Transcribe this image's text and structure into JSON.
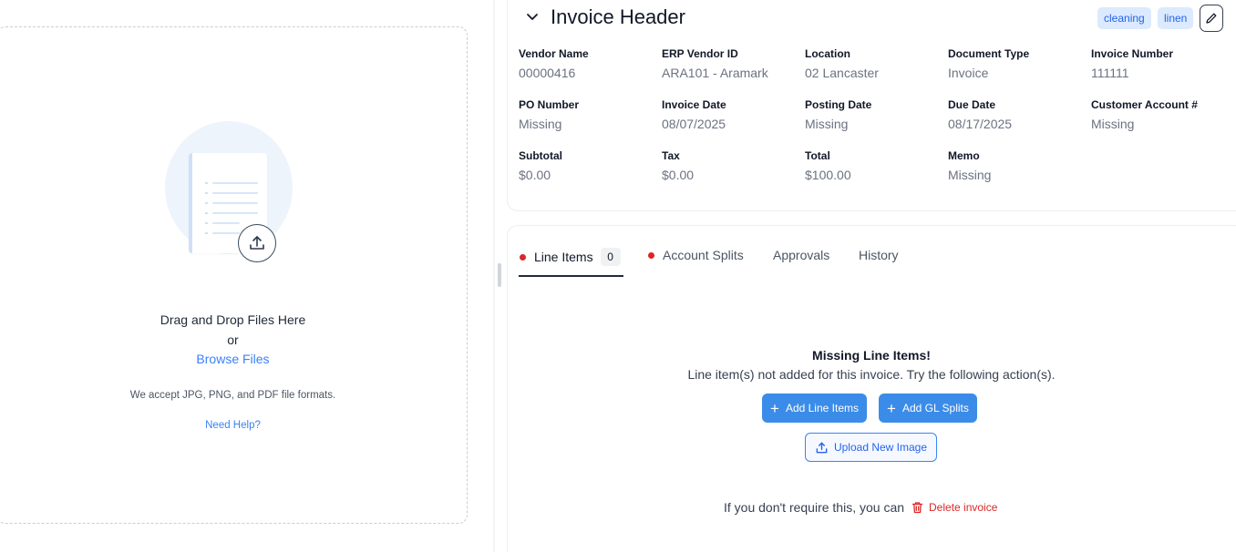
{
  "upload": {
    "drag_text": "Drag and Drop Files Here",
    "or_text": "or",
    "browse_label": "Browse Files",
    "formats_text": "We accept JPG, PNG, and PDF file formats.",
    "help_label": "Need Help?"
  },
  "header": {
    "title": "Invoice Header",
    "tags": [
      "cleaning",
      "linen"
    ],
    "fields": [
      {
        "label": "Vendor Name",
        "value": "00000416"
      },
      {
        "label": "ERP Vendor ID",
        "value": "ARA101 - Aramark"
      },
      {
        "label": "Location",
        "value": "02 Lancaster"
      },
      {
        "label": "Document Type",
        "value": "Invoice"
      },
      {
        "label": "Invoice Number",
        "value": "111111"
      },
      {
        "label": "PO Number",
        "value": "Missing"
      },
      {
        "label": "Invoice Date",
        "value": "08/07/2025"
      },
      {
        "label": "Posting Date",
        "value": "Missing"
      },
      {
        "label": "Due Date",
        "value": "08/17/2025"
      },
      {
        "label": "Customer Account #",
        "value": "Missing"
      },
      {
        "label": "Subtotal",
        "value": "$0.00"
      },
      {
        "label": "Tax",
        "value": "$0.00"
      },
      {
        "label": "Total",
        "value": "$100.00"
      },
      {
        "label": "Memo",
        "value": "Missing"
      }
    ]
  },
  "tabs": [
    {
      "label": "Line Items",
      "count": "0"
    },
    {
      "label": "Account Splits"
    },
    {
      "label": "Approvals"
    },
    {
      "label": "History"
    }
  ],
  "empty_state": {
    "title": "Missing Line Items!",
    "description": "Line item(s) not added for this invoice. Try the following action(s).",
    "add_line_items": "Add Line Items",
    "add_gl_splits": "Add GL Splits",
    "upload_image": "Upload New Image",
    "delete_prompt": "If you don't require this, you can",
    "delete_label": "Delete invoice"
  },
  "colors": {
    "accent": "#3b8ce8",
    "danger": "#dc2626",
    "tag_bg": "#dbeafe"
  }
}
